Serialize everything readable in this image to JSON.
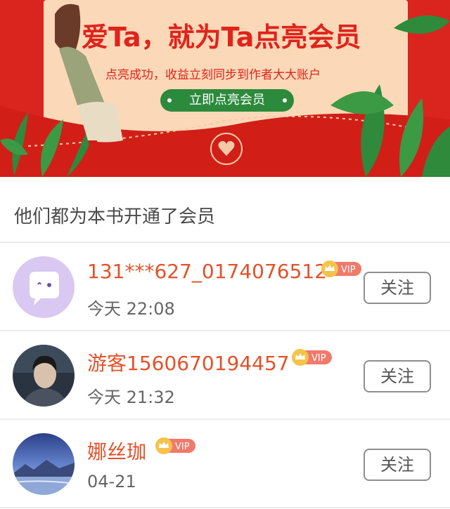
{
  "banner": {
    "title": "爱Ta，就为Ta点亮会员",
    "subtitle": "点亮成功，收益立刻同步到作者大大账户",
    "button_label": "立即点亮会员"
  },
  "section": {
    "title": "他们都为本书开通了会员"
  },
  "members": [
    {
      "name": "131***627_0174076512",
      "time": "今天 22:08",
      "badge": "VIP",
      "follow_label": "关注",
      "avatar": "default-chat-avatar"
    },
    {
      "name": "游客1560670194457",
      "time": "今天 21:32",
      "badge": "VIP",
      "follow_label": "关注",
      "avatar": "portrait-photo"
    },
    {
      "name": "娜丝珈",
      "time": "04-21",
      "badge": "VIP",
      "follow_label": "关注",
      "avatar": "landscape-photo"
    }
  ],
  "colors": {
    "banner_red": "#d9251d",
    "name_orange": "#e4512a",
    "button_green": "#2c8a3c",
    "vip_pink": "#f07a6c"
  }
}
